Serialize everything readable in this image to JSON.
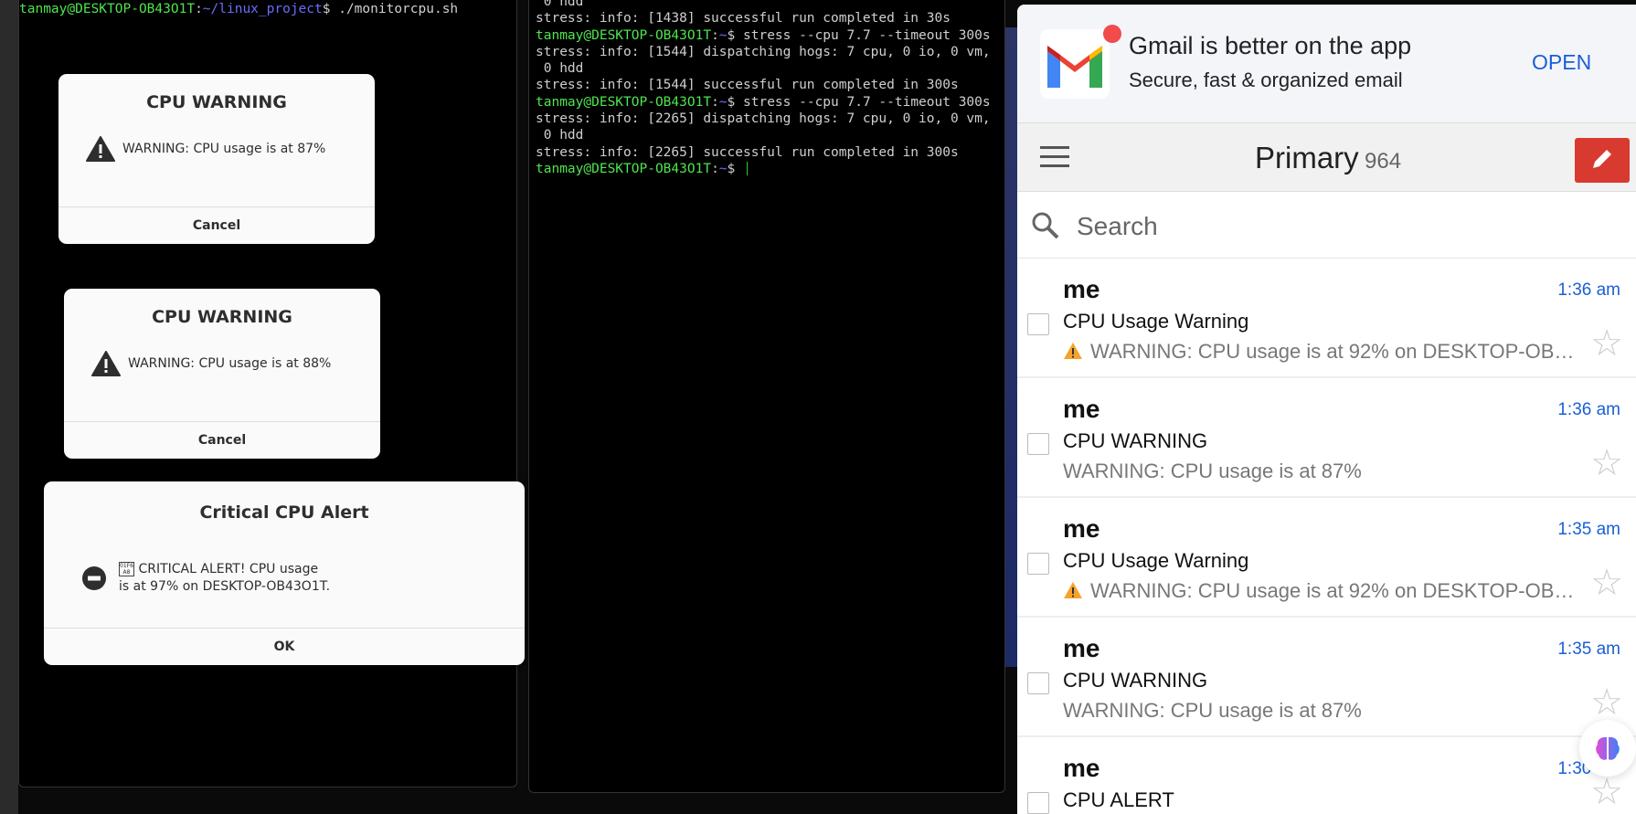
{
  "terminal_left": {
    "user_host": "tanmay@DESKTOP-OB43O1T",
    "path": "~/linux_project",
    "prompt_symbol": "$",
    "command": "./monitorcpu.sh"
  },
  "terminal_right": {
    "lines": [
      {
        "type": "out",
        "text": " 0 hdd"
      },
      {
        "type": "out",
        "text": "stress: info: [1438] successful run completed in 30s"
      },
      {
        "type": "prompt",
        "host": "tanmay@DESKTOP-OB43O1T",
        "path": "~",
        "cmd": "stress --cpu 7.7 --timeout 300s"
      },
      {
        "type": "out",
        "text": "stress: info: [1544] dispatching hogs: 7 cpu, 0 io, 0 vm,"
      },
      {
        "type": "out",
        "text": " 0 hdd"
      },
      {
        "type": "out",
        "text": "stress: info: [1544] successful run completed in 300s"
      },
      {
        "type": "prompt",
        "host": "tanmay@DESKTOP-OB43O1T",
        "path": "~",
        "cmd": "stress --cpu 7.7 --timeout 300s"
      },
      {
        "type": "out",
        "text": "stress: info: [2265] dispatching hogs: 7 cpu, 0 io, 0 vm,"
      },
      {
        "type": "out",
        "text": " 0 hdd"
      },
      {
        "type": "out",
        "text": "stress: info: [2265] successful run completed in 300s"
      },
      {
        "type": "prompt",
        "host": "tanmay@DESKTOP-OB43O1T",
        "path": "~",
        "cmd": ""
      }
    ]
  },
  "dialogs": [
    {
      "title": "CPU WARNING",
      "message": "WARNING: CPU usage is at 87%",
      "button": "Cancel",
      "icon": "warning-icon"
    },
    {
      "title": "CPU WARNING",
      "message": "WARNING: CPU usage is at 88%",
      "button": "Cancel",
      "icon": "warning-icon"
    },
    {
      "title": "Critical CPU Alert",
      "glyph": "01F6A8",
      "message_line1": "CRITICAL ALERT! CPU usage",
      "message_line2": "is at 97% on DESKTOP-OB43O1T.",
      "button": "OK",
      "icon": "error-icon"
    }
  ],
  "gmail": {
    "banner": {
      "title": "Gmail is better on the app",
      "subtitle": "Secure, fast & organized email",
      "open": "OPEN"
    },
    "toolbar": {
      "label": "Primary",
      "count": "964"
    },
    "search": {
      "placeholder": "Search"
    },
    "emails": [
      {
        "from": "me",
        "time": "1:36 am",
        "subject": "CPU Usage Warning",
        "snippet": "WARNING: CPU usage is at 92% on DESKTOP-OB…",
        "warn": true
      },
      {
        "from": "me",
        "time": "1:36 am",
        "subject": "CPU WARNING",
        "snippet": "WARNING: CPU usage is at 87%",
        "warn": false
      },
      {
        "from": "me",
        "time": "1:35 am",
        "subject": "CPU Usage Warning",
        "snippet": "WARNING: CPU usage is at 92% on DESKTOP-OB…",
        "warn": true
      },
      {
        "from": "me",
        "time": "1:35 am",
        "subject": "CPU WARNING",
        "snippet": "WARNING: CPU usage is at 87%",
        "warn": false
      },
      {
        "from": "me",
        "time": "1:30 am",
        "subject": "CPU ALERT",
        "snippet": "",
        "warn": false
      }
    ]
  },
  "colors": {
    "prompt_green": "#4ee44e",
    "path_blue": "#6b6bff",
    "gmail_blue": "#1a5fd6",
    "compose_red": "#d93a2f"
  }
}
